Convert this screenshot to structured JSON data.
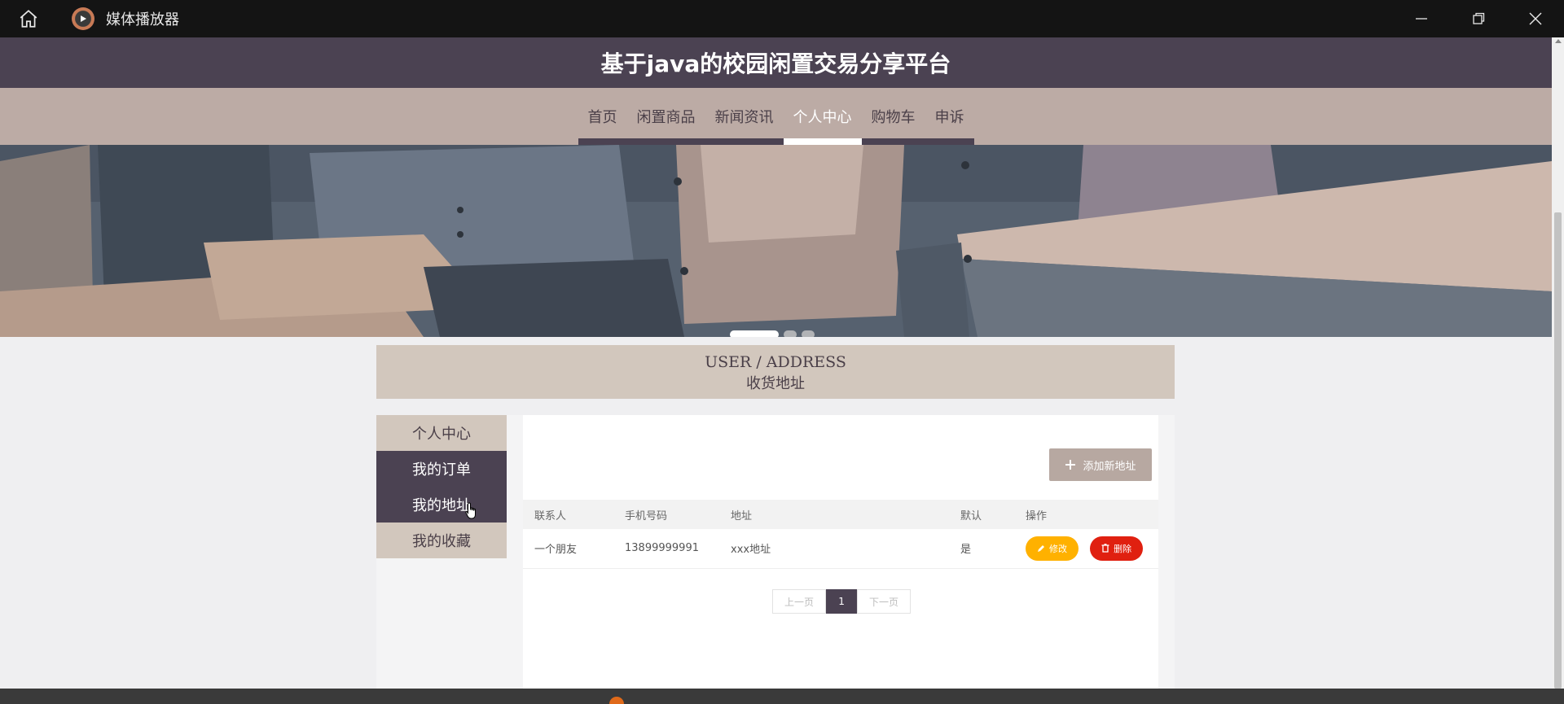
{
  "window": {
    "app_title": "媒体播放器"
  },
  "site": {
    "title": "基于java的校园闲置交易分享平台",
    "nav": [
      {
        "label": "首页",
        "active": false
      },
      {
        "label": "闲置商品",
        "active": false
      },
      {
        "label": "新闻资讯",
        "active": false
      },
      {
        "label": "个人中心",
        "active": true
      },
      {
        "label": "购物车",
        "active": false
      },
      {
        "label": "申诉",
        "active": false
      }
    ]
  },
  "banner": {
    "slides": 3,
    "active_slide": 1
  },
  "section": {
    "en_title": "USER / ADDRESS",
    "cn_title": "收货地址"
  },
  "side_menu": [
    {
      "label": "个人中心"
    },
    {
      "label": "我的订单"
    },
    {
      "label": "我的地址"
    },
    {
      "label": "我的收藏"
    }
  ],
  "toolbar": {
    "add_label": "添加新地址"
  },
  "table": {
    "headers": [
      "联系人",
      "手机号码",
      "地址",
      "默认",
      "操作"
    ],
    "rows": [
      {
        "contact": "一个朋友",
        "phone": "13899999991",
        "address": "xxx地址",
        "default": "是"
      }
    ],
    "edit_label": "修改",
    "delete_label": "删除"
  },
  "pager": {
    "prev_label": "上一页",
    "current": "1",
    "next_label": "下一页"
  },
  "colors": {
    "header_bg": "#4b4252",
    "nav_bg": "#bcaba5",
    "panel_light": "#d2c7bd",
    "edit": "#ffb100",
    "delete": "#e02010"
  }
}
